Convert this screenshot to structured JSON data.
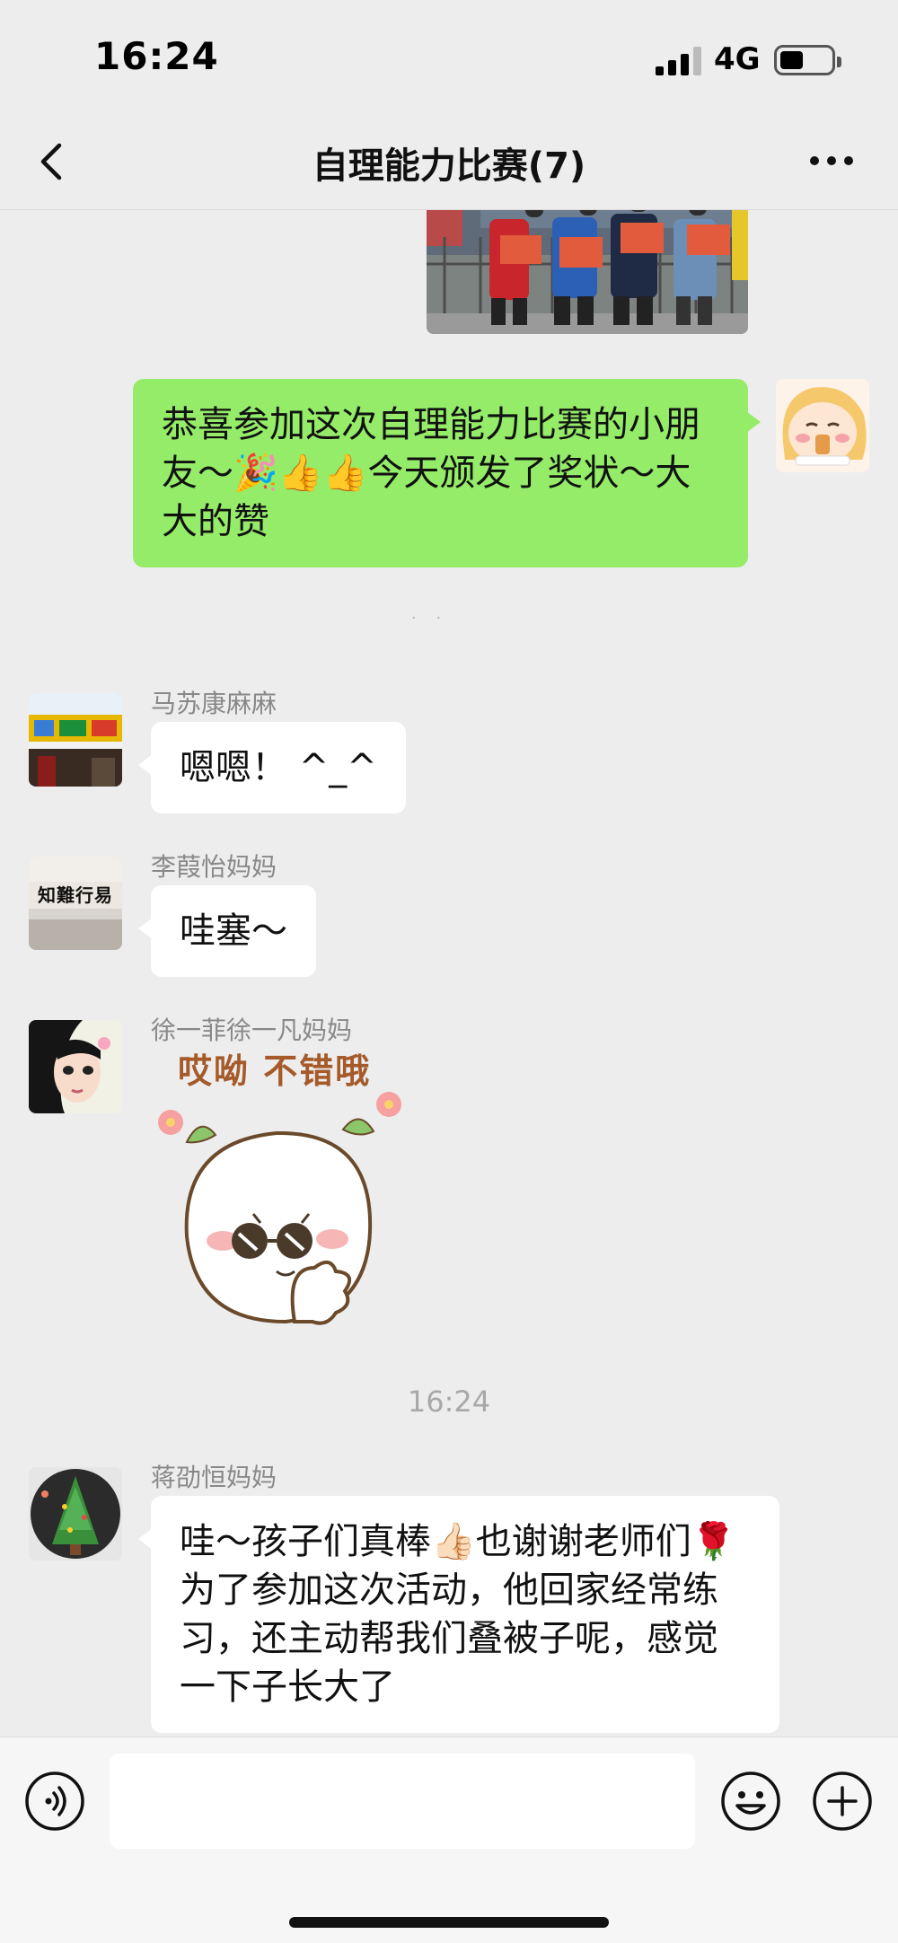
{
  "status_bar": {
    "time": "16:24",
    "network": "4G",
    "battery_level": 0.45
  },
  "nav": {
    "title": "自理能力比赛(7)"
  },
  "messages": {
    "own": {
      "text": "恭喜参加这次自理能力比赛的小朋友～🎉👍👍今天颁发了奖状～大大的赞"
    },
    "m1": {
      "sender": "马苏康麻麻",
      "text": "嗯嗯！ ^_^"
    },
    "m2": {
      "sender": "李葭怡妈妈",
      "text": "哇塞～"
    },
    "m3": {
      "sender": "徐一菲徐一凡妈妈",
      "sticker_text": "哎呦 不错哦"
    },
    "timestamp": "16:24",
    "m4": {
      "sender": "蒋劭恒妈妈",
      "text": "哇～孩子们真棒👍🏻也谢谢老师们🌹为了参加这次活动，他回家经常练习，还主动帮我们叠被子呢，感觉一下子长大了"
    }
  },
  "avatar_text": {
    "m2": "知難行易"
  },
  "icons": {
    "back": "chevron-left-icon",
    "more": "more-dots-icon",
    "voice": "voice-icon",
    "emoji": "emoji-icon",
    "plus": "plus-icon"
  },
  "colors": {
    "own_bubble": "#95ec69",
    "other_bubble": "#ffffff",
    "background": "#ededed"
  }
}
